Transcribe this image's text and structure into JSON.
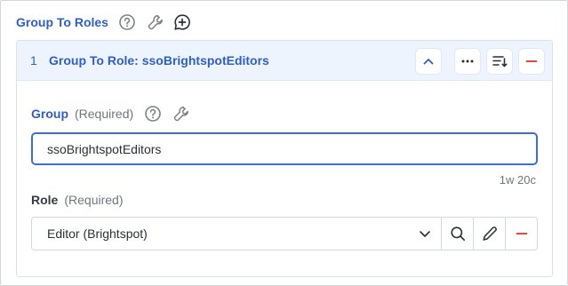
{
  "header": {
    "title": "Group To Roles",
    "icons": [
      "help-icon",
      "wrench-icon",
      "add-comment-icon"
    ]
  },
  "item": {
    "index": "1",
    "title": "Group To Role: ssoBrightspotEditors",
    "toolbar_icons": [
      "chevron-up-icon",
      "more-icon",
      "reorder-icon",
      "minus-icon"
    ]
  },
  "group_field": {
    "label": "Group",
    "required": "(Required)",
    "value": "ssoBrightspotEditors",
    "counter": "1w 20c"
  },
  "role_field": {
    "label": "Role",
    "required": "(Required)",
    "value": "Editor (Brightspot)",
    "icons": [
      "chevron-down-icon",
      "search-icon",
      "pencil-icon",
      "minus-icon"
    ]
  },
  "colors": {
    "accent": "#2f5fc4",
    "danger": "#d93025",
    "header_bg": "#eef4fd"
  }
}
